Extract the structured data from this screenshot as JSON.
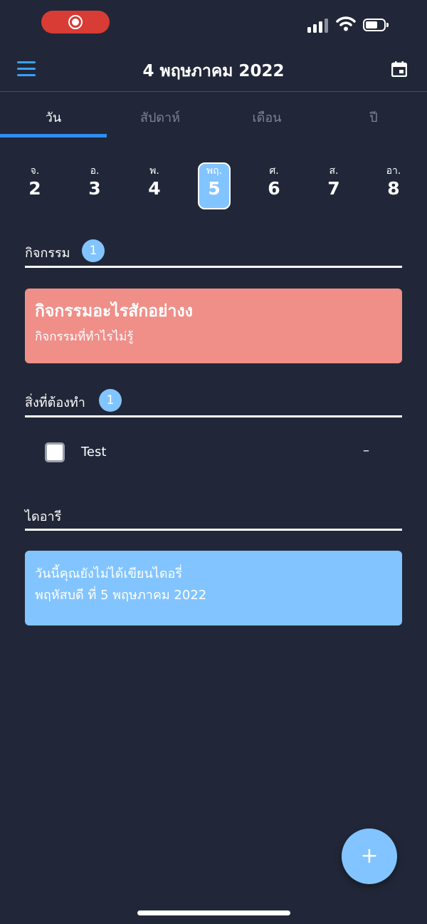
{
  "header": {
    "title": "4 พฤษภาคม 2022"
  },
  "tabs": [
    {
      "label": "วัน",
      "active": true
    },
    {
      "label": "สัปดาห์",
      "active": false
    },
    {
      "label": "เดือน",
      "active": false
    },
    {
      "label": "ปี",
      "active": false
    }
  ],
  "week": [
    {
      "name": "จ.",
      "date": "2"
    },
    {
      "name": "อ.",
      "date": "3"
    },
    {
      "name": "พ.",
      "date": "4"
    },
    {
      "name": "พฤ.",
      "date": "5",
      "selected": true
    },
    {
      "name": "ศ.",
      "date": "6"
    },
    {
      "name": "ส.",
      "date": "7"
    },
    {
      "name": "อา.",
      "date": "8"
    }
  ],
  "activities": {
    "title": "กิจกรรม",
    "count": "1",
    "items": [
      {
        "title": "กิจกรรมอะไรสักอย่างง",
        "subtitle": "กิจกรรมที่ทำไรไม่รู้"
      }
    ]
  },
  "todos": {
    "title": "สิ่งที่ต้องทำ",
    "count": "1",
    "items": [
      {
        "label": "Test",
        "trailing": "–",
        "checked": false
      }
    ]
  },
  "diary": {
    "title": "ไดอารี",
    "line1": "วันนี้คุณยังไม่ได้เขียนไดอรี่",
    "line2": "พฤหัสบดี ที่ 5 พฤษภาคม 2022"
  },
  "fab": {
    "label": "+"
  },
  "colors": {
    "background": "#212738",
    "accent": "#82c4ff",
    "event_card": "#f08e88",
    "tab_indicator": "#2f8df0",
    "record_pill": "#d93b35"
  }
}
